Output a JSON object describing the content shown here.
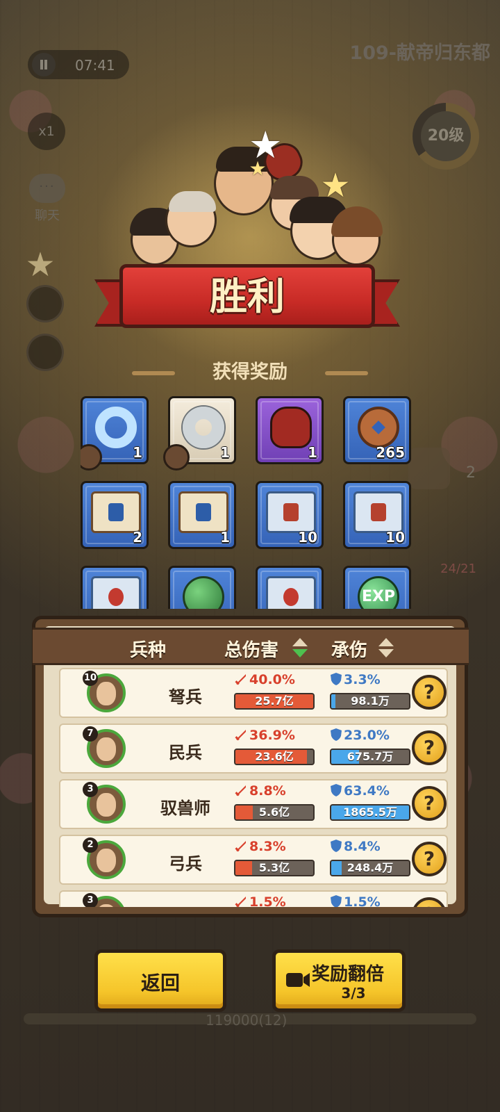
{
  "hud": {
    "timer": "07:41",
    "level_title": "109-献帝归东都",
    "speed": "x1",
    "chat_label": "聊天",
    "player_level": "20级",
    "side_count": "2",
    "side_score": "24/21",
    "bottom_score": "119000(12)"
  },
  "victory": {
    "title": "胜利",
    "rewards_title": "获得奖励"
  },
  "rewards": [
    {
      "icon": "blue-jade-icon",
      "count": "1",
      "rarity": "blue"
    },
    {
      "icon": "grey-disc-icon",
      "count": "1",
      "rarity": "white"
    },
    {
      "icon": "wine-jar-icon",
      "count": "1",
      "rarity": "purple"
    },
    {
      "icon": "copper-coin-icon",
      "count": "265",
      "rarity": "blue"
    },
    {
      "icon": "boot-scroll-icon",
      "count": "2",
      "rarity": "blue"
    },
    {
      "icon": "sword-scroll-icon",
      "count": "1",
      "rarity": "blue"
    },
    {
      "icon": "crossbow-scroll-icon",
      "count": "10",
      "rarity": "blue"
    },
    {
      "icon": "horse-scroll-icon",
      "count": "10",
      "rarity": "blue"
    },
    {
      "icon": "red-scroll-icon",
      "count": "",
      "rarity": "blue"
    },
    {
      "icon": "green-orb-icon",
      "count": "",
      "rarity": "blue"
    },
    {
      "icon": "tiger-scroll-icon",
      "count": "",
      "rarity": "blue"
    },
    {
      "icon": "exp-orb-icon",
      "count": "",
      "rarity": "blue",
      "text": "EXP"
    }
  ],
  "stats": {
    "headers": {
      "unit": "兵种",
      "damage": "总伤害",
      "taken": "承伤"
    },
    "rows": [
      {
        "level": "10",
        "name": "弩兵",
        "damage_pct": "40.0%",
        "damage_val": "25.7亿",
        "taken_pct": "3.3%",
        "taken_val": "98.1万",
        "damage_ratio": 1.0,
        "taken_ratio": 0.05
      },
      {
        "level": "7",
        "name": "民兵",
        "damage_pct": "36.9%",
        "damage_val": "23.6亿",
        "taken_pct": "23.0%",
        "taken_val": "675.7万",
        "damage_ratio": 0.92,
        "taken_ratio": 0.36
      },
      {
        "level": "3",
        "name": "驭兽师",
        "damage_pct": "8.8%",
        "damage_val": "5.6亿",
        "taken_pct": "63.4%",
        "taken_val": "1865.5万",
        "damage_ratio": 0.22,
        "taken_ratio": 1.0
      },
      {
        "level": "2",
        "name": "弓兵",
        "damage_pct": "8.3%",
        "damage_val": "5.3亿",
        "taken_pct": "8.4%",
        "taken_val": "248.4万",
        "damage_ratio": 0.21,
        "taken_ratio": 0.13
      },
      {
        "level": "3",
        "name": "",
        "damage_pct": "1.5%",
        "damage_val": "",
        "taken_pct": "1.5%",
        "taken_val": "",
        "damage_ratio": 0.04,
        "taken_ratio": 0.03
      }
    ],
    "help_label": "?"
  },
  "buttons": {
    "back": "返回",
    "double": "奖励翻倍",
    "double_count": "3/3"
  },
  "colors": {
    "button_yellow": "#f5c52a",
    "banner_red": "#c82b26",
    "damage_red": "#e45a38",
    "taken_blue": "#4aa7ea"
  }
}
